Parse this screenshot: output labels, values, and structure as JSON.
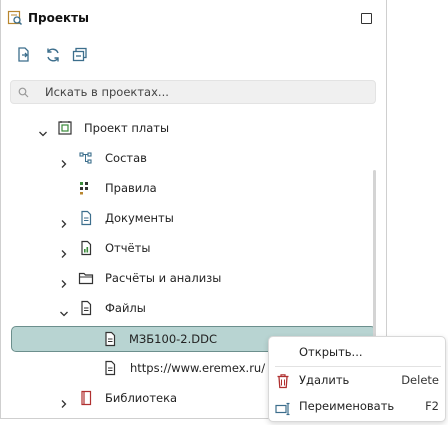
{
  "panel": {
    "title": "Проекты",
    "icons": {
      "title": "projects-icon",
      "maximize": "maximize-icon"
    }
  },
  "toolbar": {
    "buttons": [
      {
        "name": "add-project-button",
        "icon": "add-document-icon"
      },
      {
        "name": "refresh-button",
        "icon": "refresh-icon"
      },
      {
        "name": "collapse-all-button",
        "icon": "collapse-all-icon"
      }
    ]
  },
  "search": {
    "placeholder": "Искать в проектах..."
  },
  "tree": {
    "project": {
      "label": "Проект платы",
      "icon": "board-icon",
      "expanded": true
    },
    "items": [
      {
        "label": "Состав",
        "icon": "hierarchy-icon",
        "expandable": true,
        "expanded": false
      },
      {
        "label": "Правила",
        "icon": "rules-icon",
        "expandable": false
      },
      {
        "label": "Документы",
        "icon": "documents-icon",
        "expandable": true,
        "expanded": false
      },
      {
        "label": "Отчёты",
        "icon": "reports-icon",
        "expandable": true,
        "expanded": false
      },
      {
        "label": "Расчёты и анализы",
        "icon": "folder-icon",
        "expandable": true,
        "expanded": false
      },
      {
        "label": "Файлы",
        "icon": "files-icon",
        "expandable": true,
        "expanded": true
      }
    ],
    "files": [
      {
        "label": "МЗБ100-2.DDC",
        "icon": "file-icon",
        "selected": true
      },
      {
        "label": "https://www.eremex.ru/",
        "icon": "file-icon",
        "selected": false
      }
    ],
    "library": {
      "label": "Библиотека",
      "icon": "library-icon",
      "expandable": true
    }
  },
  "context_menu": {
    "items": [
      {
        "label": "Открыть...",
        "shortcut": "",
        "icon": ""
      },
      {
        "label": "Удалить",
        "shortcut": "Delete",
        "icon": "trash-icon"
      },
      {
        "label": "Переименовать",
        "shortcut": "F2",
        "icon": "rename-icon"
      }
    ]
  },
  "colors": {
    "selection": "#b8d4d2",
    "selection_border": "#6c8f8d",
    "accent": "#3c6e8c"
  }
}
